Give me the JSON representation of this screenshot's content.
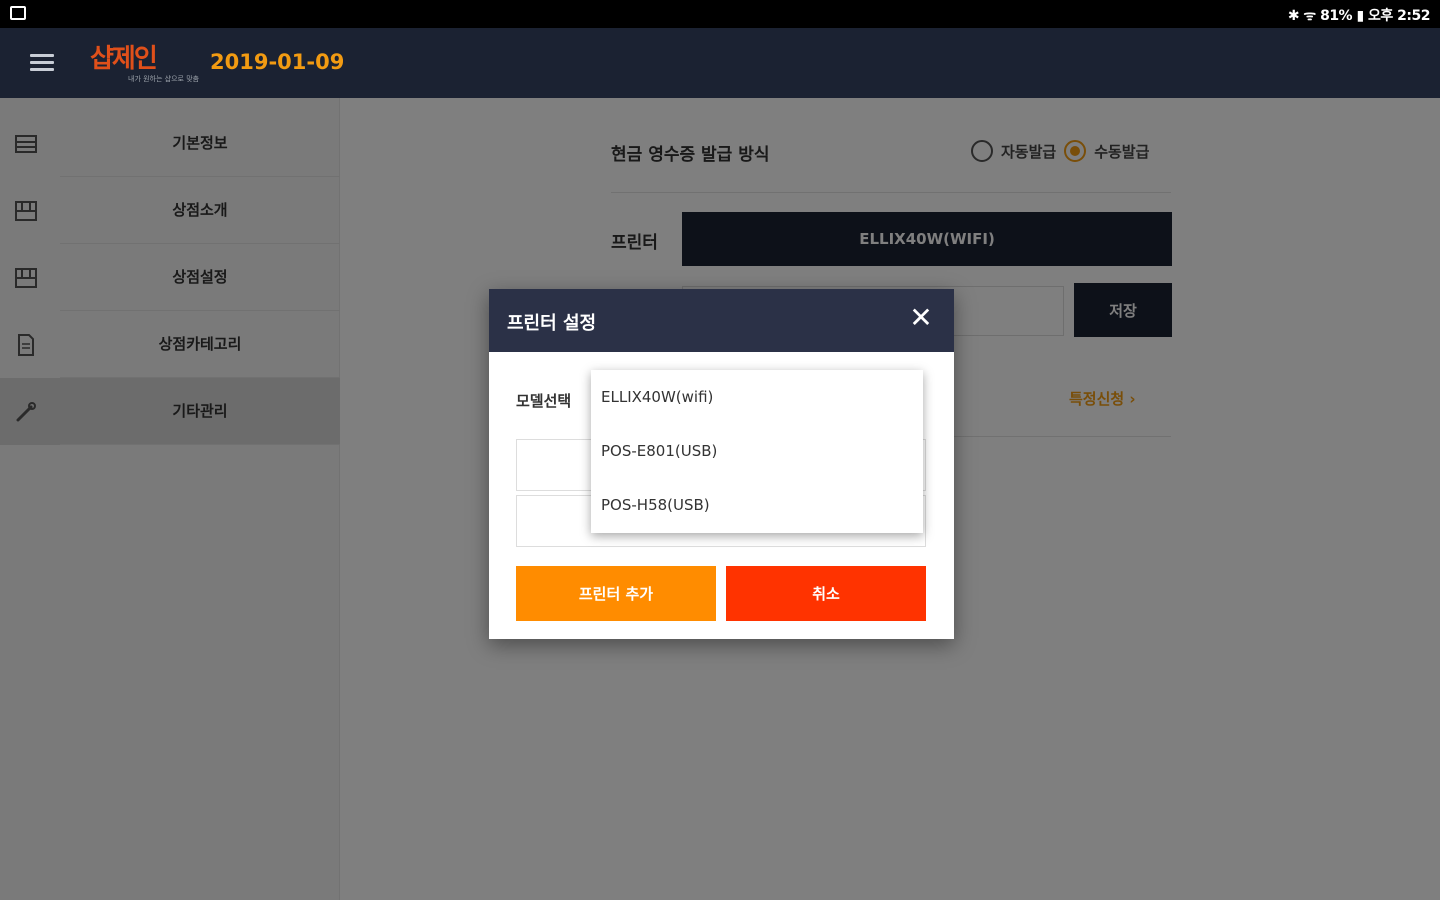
{
  "status_bar": {
    "right_text": "✱ ᯤ 81% ▮ 오후 2:52"
  },
  "header": {
    "logo_text": "샵제인",
    "logo_subtext": "내가 원하는 샵으로 맞춤",
    "date": "2019-01-09"
  },
  "sidebar": {
    "items": [
      {
        "label": "기본정보",
        "icon": "store-icon"
      },
      {
        "label": "상점소개",
        "icon": "shop-icon"
      },
      {
        "label": "상점설정",
        "icon": "shop-settings-icon"
      },
      {
        "label": "상점카테고리",
        "icon": "document-icon"
      },
      {
        "label": "기타관리",
        "icon": "wrench-icon"
      }
    ],
    "active_index": 4
  },
  "main": {
    "receipt_label": "현금 영수증 발급 방식",
    "radio_auto": "자동발급",
    "radio_manual": "수동발급",
    "radio_selected": "수동발급",
    "printer_label": "프린터",
    "printer_value": "ELLIX40W(WIFI)",
    "save_label": "저장",
    "register_link": "특정신청 ›"
  },
  "modal": {
    "title": "프린터 설정",
    "close_icon": "close-icon",
    "model_label": "모델선택",
    "add_label": "프린터 추가",
    "cancel_label": "취소",
    "options": [
      "ELLIX40W(wifi)",
      "POS-E801(USB)",
      "POS-H58(USB)"
    ]
  },
  "colors": {
    "header_bg": "#1b2232",
    "accent_orange": "#f29b12",
    "add_button": "#ff8c00",
    "cancel_button": "#ff3300",
    "modal_header": "#2b3147"
  }
}
